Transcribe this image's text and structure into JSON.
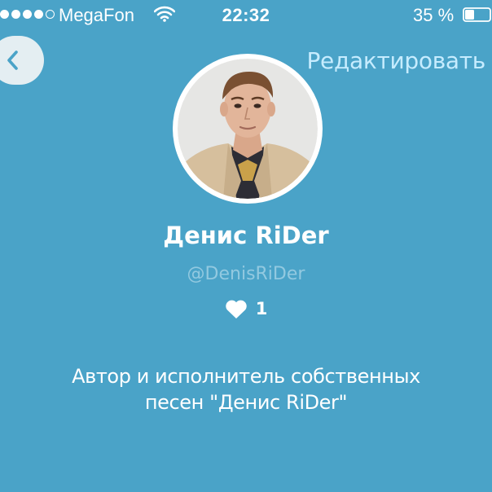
{
  "status_bar": {
    "carrier": "MegaFon",
    "time": "22:32",
    "battery": "35 %",
    "signal_strength": "4 of 5",
    "icons": [
      "signal-dots-icon",
      "wifi-icon",
      "battery-icon"
    ]
  },
  "header": {
    "back_icon": "chevron-left-icon",
    "edit_label": "Редактировать"
  },
  "profile": {
    "avatar_icon": "avatar",
    "name": "Денис RiDer",
    "handle": "@DenisRiDer",
    "likes_icon": "heart-icon",
    "likes_count": "1",
    "bio_line_1": "Автор и исполнитель собственных",
    "bio_line_2": "песен \"Денис RiDer\""
  },
  "colors": {
    "background": "#4aa3c8",
    "edit_link": "#c6ecff",
    "handle": "#92c9e0",
    "back_button": "#e4eef2"
  }
}
